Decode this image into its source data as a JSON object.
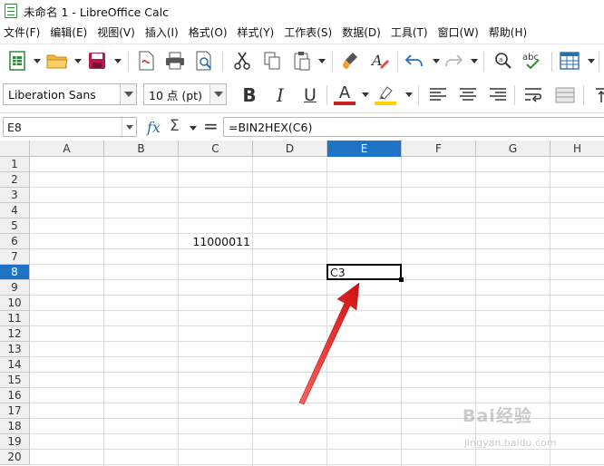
{
  "window": {
    "title": "未命名 1 - LibreOffice Calc"
  },
  "menu": [
    "文件(F)",
    "编辑(E)",
    "视图(V)",
    "插入(I)",
    "格式(O)",
    "样式(Y)",
    "工作表(S)",
    "数据(D)",
    "工具(T)",
    "窗口(W)",
    "帮助(H)"
  ],
  "format_bar": {
    "font_name": "Liberation Sans",
    "font_size": "10 点 (pt)",
    "bold": "B",
    "italic": "I",
    "underline": "U",
    "font_color": "A",
    "font_color_value": "#cc1f1f",
    "highlight_color_value": "#ffd200"
  },
  "formula_bar": {
    "cell_ref": "E8",
    "formula": "=BIN2HEX(C6)",
    "fx_label": "fx",
    "sigma": "Σ",
    "equals": "="
  },
  "sheet": {
    "columns": [
      "A",
      "B",
      "C",
      "D",
      "E",
      "F",
      "G",
      "H"
    ],
    "active_column": "E",
    "rows": [
      "1",
      "2",
      "3",
      "4",
      "5",
      "6",
      "7",
      "8",
      "9",
      "10",
      "11",
      "12",
      "13",
      "14",
      "15",
      "16",
      "17",
      "18",
      "19",
      "20"
    ],
    "active_row": "8",
    "cells": {
      "C6": "11000011",
      "E8": "C3"
    },
    "selected_cell": "E8"
  },
  "annotation": {
    "arrow_color": "#e02020"
  },
  "watermark": {
    "line1": "Bai经验",
    "line2": "jingyan.baidu.com"
  }
}
